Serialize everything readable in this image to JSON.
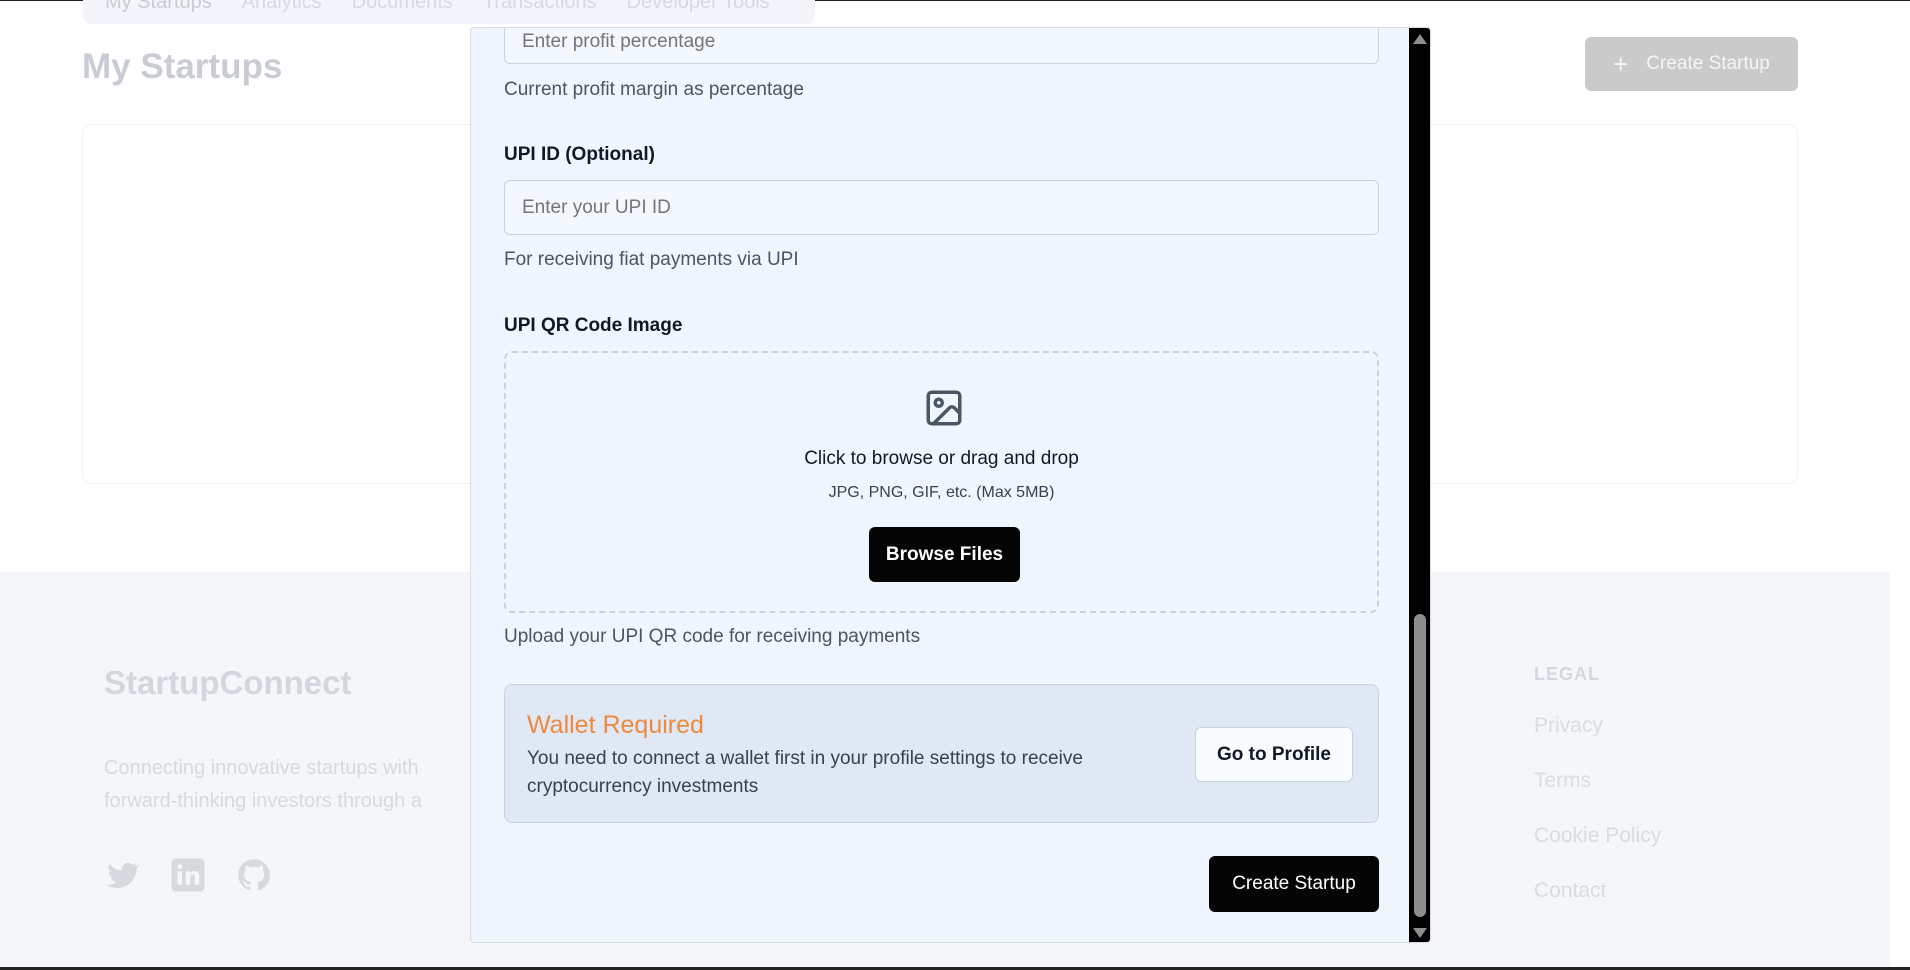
{
  "background": {
    "tabs": [
      "My Startups",
      "Analytics",
      "Documents",
      "Transactions",
      "Developer Tools"
    ],
    "page_title": "My Startups",
    "create_button": "Create Startup",
    "footer": {
      "brand": "StartupConnect",
      "description": "Connecting innovative startups with forward-thinking investors through a secure, transparent platform.",
      "social_icons": [
        "twitter-icon",
        "linkedin-icon",
        "github-icon"
      ],
      "legal_title": "LEGAL",
      "legal_links": [
        "Privacy",
        "Terms",
        "Cookie Policy",
        "Contact"
      ]
    }
  },
  "modal": {
    "profit_input": {
      "placeholder": "Enter profit percentage"
    },
    "profit_helper": "Current profit margin as percentage",
    "upi_label": "UPI ID (Optional)",
    "upi_input": {
      "placeholder": "Enter your UPI ID"
    },
    "upi_helper": "For receiving fiat payments via UPI",
    "qr_label": "UPI QR Code Image",
    "dropzone": {
      "icon": "image-icon",
      "title": "Click to browse or drag and drop",
      "subtitle": "JPG, PNG, GIF, etc. (Max 5MB)",
      "button": "Browse Files"
    },
    "qr_helper": "Upload your UPI QR code for receiving payments",
    "wallet": {
      "title": "Wallet Required",
      "text": "You need to connect a wallet first in your profile settings to receive cryptocurrency investments",
      "button": "Go to Profile"
    },
    "submit_button": "Create Startup"
  },
  "colors": {
    "wallet_title": "#ee8a3d",
    "primary_button": "#050505",
    "modal_background": "#f0f6fe"
  }
}
